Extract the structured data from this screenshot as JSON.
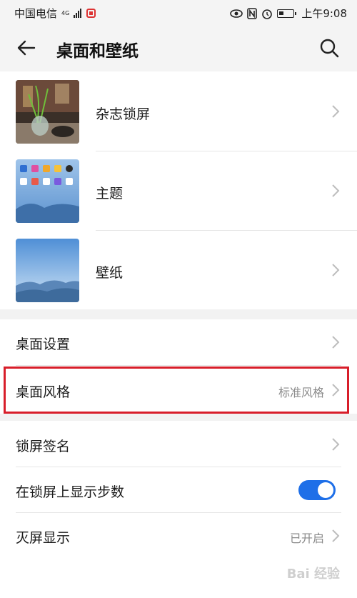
{
  "status_bar": {
    "carrier": "中国电信",
    "network": "4G",
    "time": "上午9:08"
  },
  "header": {
    "title": "桌面和壁纸"
  },
  "media_rows": [
    {
      "label": "杂志锁屏"
    },
    {
      "label": "主题"
    },
    {
      "label": "壁纸"
    }
  ],
  "settings": {
    "desktop_settings": {
      "label": "桌面设置"
    },
    "desktop_style": {
      "label": "桌面风格",
      "value": "标准风格"
    },
    "lock_signature": {
      "label": "锁屏签名"
    },
    "show_steps": {
      "label": "在锁屏上显示步数",
      "enabled": true
    },
    "screen_off_display": {
      "label": "灭屏显示",
      "value": "已开启"
    }
  },
  "watermark": "Bai 经验",
  "colors": {
    "accent": "#1e6fe8",
    "highlight_box": "#d81e2a",
    "background_gray": "#f4f4f4"
  },
  "icons": [
    "back-arrow-icon",
    "search-icon",
    "chevron-right-icon",
    "eye-icon",
    "nfc-icon",
    "alarm-icon",
    "battery-icon",
    "signal-icon"
  ]
}
